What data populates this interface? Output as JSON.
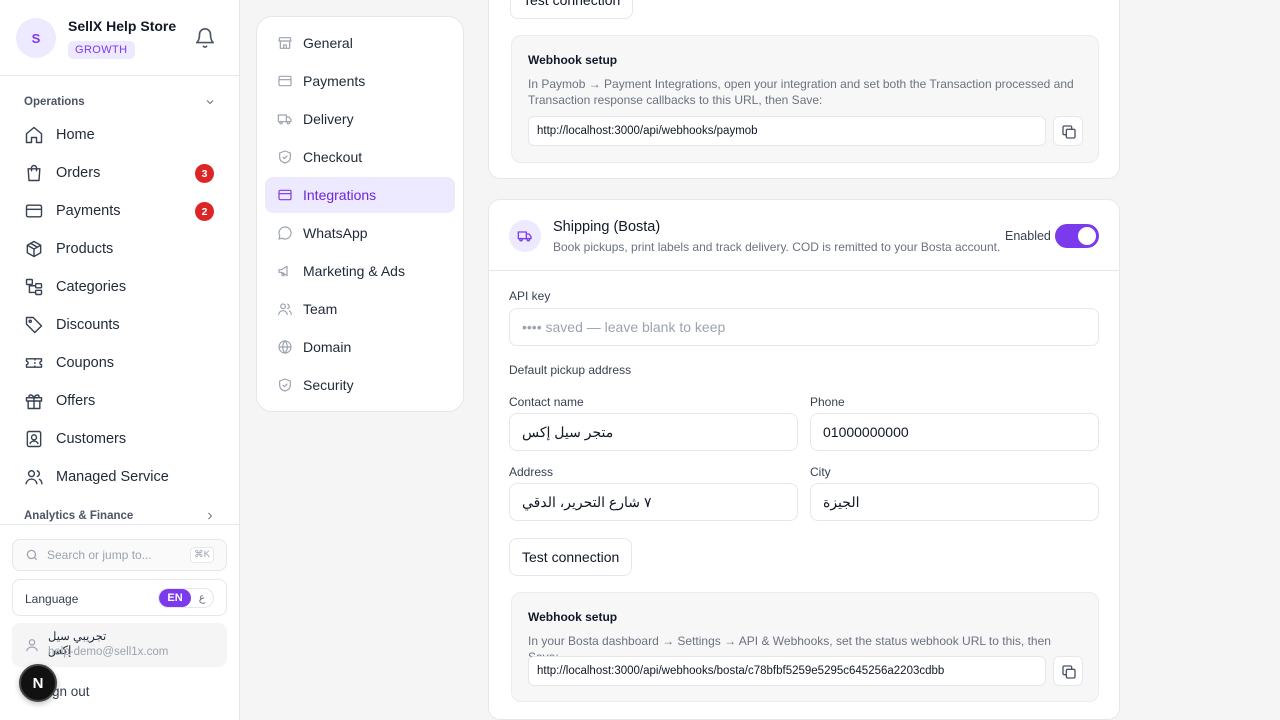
{
  "store": {
    "initial": "S",
    "name": "SellX Help Store",
    "plan": "GROWTH"
  },
  "sidebar": {
    "section_operations": "Operations",
    "section_analytics": "Analytics & Finance",
    "items": [
      {
        "label": "Home"
      },
      {
        "label": "Orders",
        "badge": "3"
      },
      {
        "label": "Payments",
        "badge": "2"
      },
      {
        "label": "Products"
      },
      {
        "label": "Categories"
      },
      {
        "label": "Discounts"
      },
      {
        "label": "Coupons"
      },
      {
        "label": "Offers"
      },
      {
        "label": "Customers"
      },
      {
        "label": "Managed Service"
      }
    ],
    "search_placeholder": "Search or jump to...",
    "search_shortcut": "⌘K",
    "language_label": "Language",
    "lang_en": "EN",
    "lang_ar": "ع",
    "user_name": "تجريبي سيل إكس",
    "user_email": "help-demo@sell1x.com",
    "sign_out": "Sign out",
    "next_badge": "N"
  },
  "settings_nav": [
    {
      "label": "General",
      "icon": "store-icon"
    },
    {
      "label": "Payments",
      "icon": "card-icon"
    },
    {
      "label": "Delivery",
      "icon": "truck-icon"
    },
    {
      "label": "Checkout",
      "icon": "shield-check-icon"
    },
    {
      "label": "Integrations",
      "icon": "card-icon",
      "active": true
    },
    {
      "label": "WhatsApp",
      "icon": "chat-icon"
    },
    {
      "label": "Marketing & Ads",
      "icon": "megaphone-icon"
    },
    {
      "label": "Team",
      "icon": "users-icon"
    },
    {
      "label": "Domain",
      "icon": "globe-icon"
    },
    {
      "label": "Security",
      "icon": "shield-icon"
    }
  ],
  "paymob": {
    "test_button": "Test connection",
    "webhook_title": "Webhook setup",
    "webhook_desc": "In Paymob → Payment Integrations, open your integration and set both the Transaction processed and Transaction response callbacks to this URL, then Save:",
    "webhook_url": "http://localhost:3000/api/webhooks/paymob"
  },
  "bosta": {
    "title": "Shipping (Bosta)",
    "description": "Book pickups, print labels and track delivery. COD is remitted to your Bosta account.",
    "enabled_label": "Enabled",
    "enabled": true,
    "api_key_label": "API key",
    "api_key_placeholder": "•••• saved — leave blank to keep",
    "pickup_heading": "Default pickup address",
    "contact_label": "Contact name",
    "contact_value": "متجر سيل إكس",
    "phone_label": "Phone",
    "phone_value": "01000000000",
    "address_label": "Address",
    "address_value": "٧ شارع التحرير، الدقي",
    "city_label": "City",
    "city_value": "الجيزة",
    "test_button": "Test connection",
    "webhook_title": "Webhook setup",
    "webhook_desc": "In your Bosta dashboard → Settings → API & Webhooks, set the status webhook URL to this, then Save:",
    "webhook_url": "http://localhost:3000/api/webhooks/bosta/c78bfbf5259e5295c645256a2203cdbb"
  },
  "colors": {
    "accent": "#7c3aed",
    "accent_soft": "#ede9fe",
    "badge": "#dc2626"
  }
}
